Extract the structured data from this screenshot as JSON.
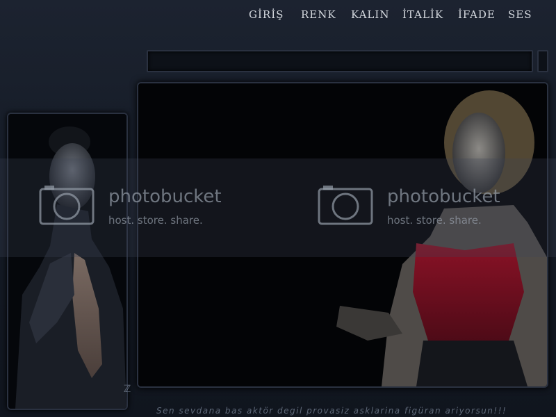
{
  "nav": {
    "items": [
      {
        "label": "GİRİŞ"
      },
      {
        "label": "RENK"
      },
      {
        "label": "KALIN"
      },
      {
        "label": "İTALİK"
      },
      {
        "label": "İFADE"
      },
      {
        "label": "SES"
      }
    ]
  },
  "watermark": {
    "brand": "photobucket",
    "tagline": "host. store. share."
  },
  "footer": {
    "text": "Sen sevdana bas aktör degil provasiz asklarina figüran ariyorsun!!!"
  },
  "colors": {
    "background": "#1c2330",
    "panel": "#030406",
    "panel_border": "#2a3140",
    "nav_text": "#d6dae0",
    "accent_red": "#8a1226"
  },
  "icons": {
    "watermark": "camera-icon"
  }
}
